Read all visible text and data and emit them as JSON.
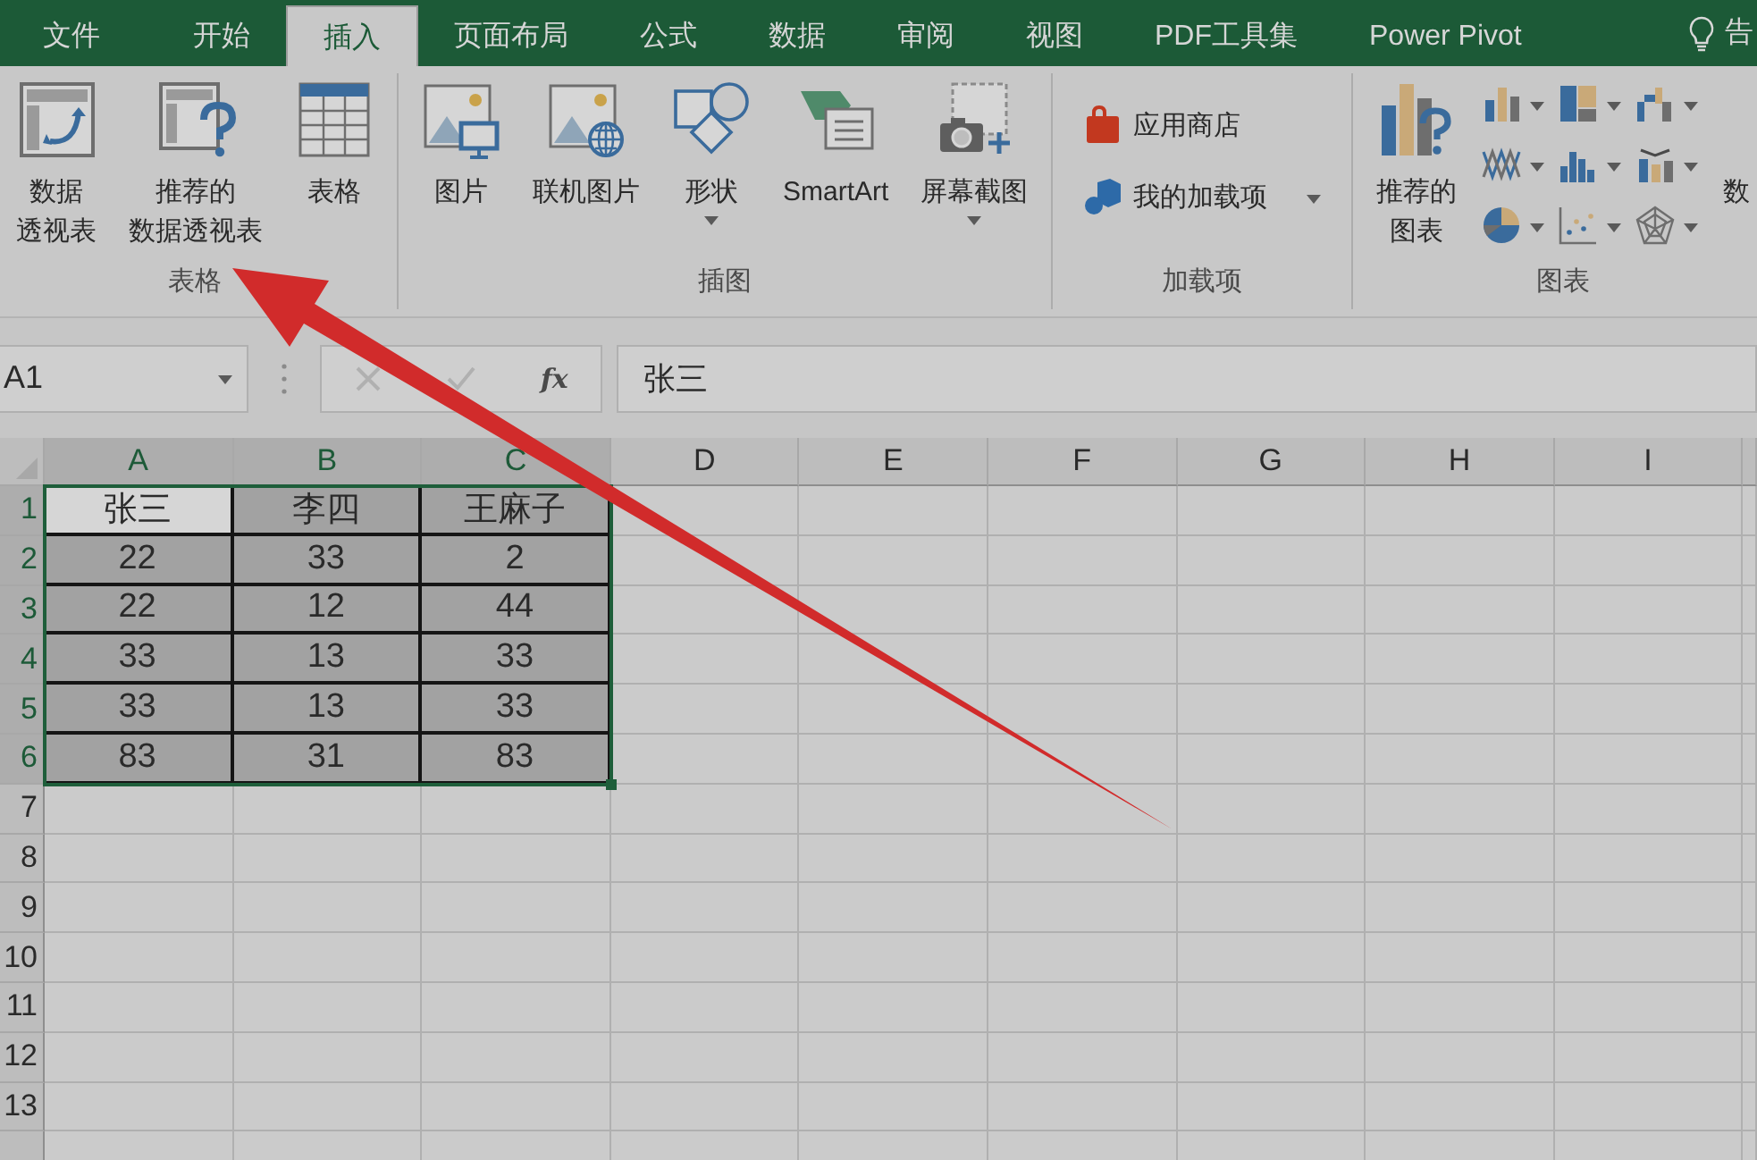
{
  "ribbon_tabs": [
    {
      "label": "文件",
      "selected": false
    },
    {
      "label": "开始",
      "selected": false
    },
    {
      "label": "插入",
      "selected": true
    },
    {
      "label": "页面布局",
      "selected": false
    },
    {
      "label": "公式",
      "selected": false
    },
    {
      "label": "数据",
      "selected": false
    },
    {
      "label": "审阅",
      "selected": false
    },
    {
      "label": "视图",
      "selected": false
    },
    {
      "label": "PDF工具集",
      "selected": false
    },
    {
      "label": "Power Pivot",
      "selected": false
    }
  ],
  "tell_me": "告",
  "ribbon_groups": [
    {
      "label": "表格",
      "commands": [
        {
          "kind": "large",
          "lines": [
            "数据",
            "透视表"
          ],
          "dropdown": false
        },
        {
          "kind": "large",
          "lines": [
            "推荐的",
            "数据透视表"
          ],
          "dropdown": false
        },
        {
          "kind": "large",
          "lines": [
            "表格"
          ],
          "dropdown": false
        }
      ]
    },
    {
      "label": "插图",
      "commands": [
        {
          "kind": "large",
          "lines": [
            "图片"
          ],
          "dropdown": false
        },
        {
          "kind": "large",
          "lines": [
            "联机图片"
          ],
          "dropdown": false
        },
        {
          "kind": "large",
          "lines": [
            "形状"
          ],
          "dropdown": true
        },
        {
          "kind": "large",
          "lines": [
            "SmartArt"
          ],
          "dropdown": false
        },
        {
          "kind": "large",
          "lines": [
            "屏幕截图"
          ],
          "dropdown": true
        }
      ]
    },
    {
      "label": "加载项",
      "commands": [
        {
          "kind": "small",
          "label": "应用商店",
          "dropdown": false
        },
        {
          "kind": "small",
          "label": "我的加载项",
          "dropdown": true
        }
      ]
    },
    {
      "label": "图表",
      "commands": [
        {
          "kind": "large",
          "lines": [
            "推荐的",
            "图表"
          ],
          "dropdown": false
        },
        {
          "kind": "gallery",
          "items": [
            {
              "dropdown": true
            },
            {
              "dropdown": true
            },
            {
              "dropdown": true
            },
            {
              "dropdown": true
            },
            {
              "dropdown": true
            },
            {
              "dropdown": true
            },
            {
              "dropdown": true
            },
            {
              "dropdown": true
            },
            {
              "dropdown": true
            }
          ]
        },
        {
          "kind": "large",
          "lines": [
            "数"
          ],
          "dropdown": false
        }
      ]
    }
  ],
  "formula_bar": {
    "name_box": "A1",
    "function_button": "fx",
    "value": "张三"
  },
  "sheet": {
    "columns": [
      {
        "label": "A",
        "selected": true
      },
      {
        "label": "B",
        "selected": true
      },
      {
        "label": "C",
        "selected": true
      },
      {
        "label": "D",
        "selected": false
      },
      {
        "label": "E",
        "selected": false
      },
      {
        "label": "F",
        "selected": false
      },
      {
        "label": "G",
        "selected": false
      },
      {
        "label": "H",
        "selected": false
      },
      {
        "label": "I",
        "selected": false
      }
    ],
    "rows": [
      {
        "number": "1",
        "selected": true,
        "cells": [
          {
            "text": "张三",
            "active": true
          },
          {
            "text": "李四",
            "active": false
          },
          {
            "text": "王麻子",
            "active": false
          }
        ]
      },
      {
        "number": "2",
        "selected": true,
        "cells": [
          {
            "text": "22",
            "active": false
          },
          {
            "text": "33",
            "active": false
          },
          {
            "text": "2",
            "active": false
          }
        ]
      },
      {
        "number": "3",
        "selected": true,
        "cells": [
          {
            "text": "22",
            "active": false
          },
          {
            "text": "12",
            "active": false
          },
          {
            "text": "44",
            "active": false
          }
        ]
      },
      {
        "number": "4",
        "selected": true,
        "cells": [
          {
            "text": "33",
            "active": false
          },
          {
            "text": "13",
            "active": false
          },
          {
            "text": "33",
            "active": false
          }
        ]
      },
      {
        "number": "5",
        "selected": true,
        "cells": [
          {
            "text": "33",
            "active": false
          },
          {
            "text": "13",
            "active": false
          },
          {
            "text": "33",
            "active": false
          }
        ]
      },
      {
        "number": "6",
        "selected": true,
        "cells": [
          {
            "text": "83",
            "active": false
          },
          {
            "text": "31",
            "active": false
          },
          {
            "text": "83",
            "active": false
          }
        ]
      },
      {
        "number": "7",
        "selected": false
      },
      {
        "number": "8",
        "selected": false
      },
      {
        "number": "9",
        "selected": false
      },
      {
        "number": "10",
        "selected": false
      },
      {
        "number": "11",
        "selected": false
      },
      {
        "number": "12",
        "selected": false
      },
      {
        "number": "13",
        "selected": false
      }
    ]
  }
}
